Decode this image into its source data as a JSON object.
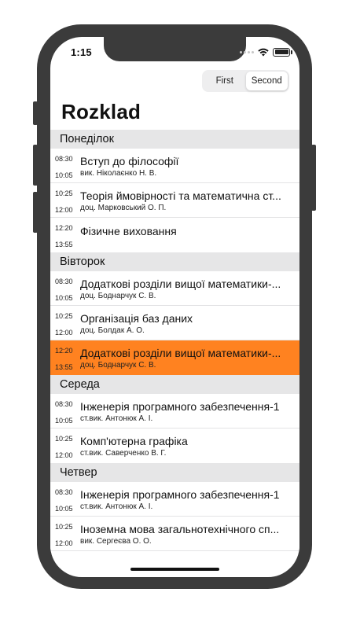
{
  "status_bar": {
    "time": "1:15",
    "icons": [
      "signal-icon",
      "wifi-icon",
      "battery-icon"
    ]
  },
  "segmented_control": {
    "options": [
      "First",
      "Second"
    ],
    "selected": "Second"
  },
  "title": "Rozklad",
  "colors": {
    "accent": "#ff8220",
    "section_header_bg": "#e6e6e7",
    "device_frame": "#3b3b3b"
  },
  "days": [
    {
      "name": "Понеділок",
      "lessons": [
        {
          "start": "08:30",
          "end": "10:05",
          "subject": "Вступ до філософії",
          "teacher": "вик. Ніколаєнко Н. В."
        },
        {
          "start": "10:25",
          "end": "12:00",
          "subject": "Теорія ймовірності та математична ст...",
          "teacher": "доц. Марковський О. П."
        },
        {
          "start": "12:20",
          "end": "13:55",
          "subject": "Фізичне виховання",
          "teacher": ""
        }
      ]
    },
    {
      "name": "Вівторок",
      "lessons": [
        {
          "start": "08:30",
          "end": "10:05",
          "subject": "Додаткові розділи вищої математики-...",
          "teacher": "доц. Боднарчук С. В."
        },
        {
          "start": "10:25",
          "end": "12:00",
          "subject": "Організація баз даних",
          "teacher": "доц. Болдак А. О."
        },
        {
          "start": "12:20",
          "end": "13:55",
          "subject": "Додаткові розділи вищої математики-...",
          "teacher": "доц. Боднарчук С. В.",
          "highlighted": true
        }
      ]
    },
    {
      "name": "Середа",
      "lessons": [
        {
          "start": "08:30",
          "end": "10:05",
          "subject": "Інженерія програмного забезпечення-1",
          "teacher": "ст.вик. Антонюк А. І."
        },
        {
          "start": "10:25",
          "end": "12:00",
          "subject": "Комп'ютерна графіка",
          "teacher": "ст.вик. Саверченко В. Г."
        }
      ]
    },
    {
      "name": "Четвер",
      "lessons": [
        {
          "start": "08:30",
          "end": "10:05",
          "subject": "Інженерія програмного забезпечення-1",
          "teacher": "ст.вик. Антонюк А. І."
        },
        {
          "start": "10:25",
          "end": "12:00",
          "subject": "Іноземна мова загальнотехнічного сп...",
          "teacher": "вик. Сергеєва О. О."
        }
      ]
    }
  ]
}
